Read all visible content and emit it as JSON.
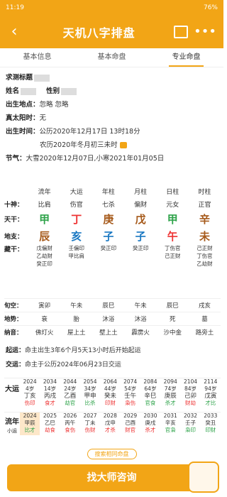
{
  "status": {
    "time": "11:19",
    "battery": "76%"
  },
  "appbar": {
    "title": "天机八字排盘"
  },
  "tabs": [
    "基本信息",
    "基本命盘",
    "专业命盘"
  ],
  "info": {
    "test_label": "求测标题",
    "name_label": "姓名",
    "gender_label": "性别",
    "birthplace_label": "出生地点：",
    "birthplace_value": "忽略 忽略",
    "solar_label": "真太阳时：",
    "solar_value": "无",
    "birthtime_label": "出生时间：",
    "birthtime_value": "公历2020年12月17日 13时18分",
    "lunar_value": "农历2020年冬月初三未时",
    "jieqi_label": "节气：",
    "jieqi_value": "大雪2020年12月07日,小寒2021年01月05日"
  },
  "pillars": {
    "headers": [
      "流年",
      "大运",
      "年柱",
      "月柱",
      "日柱",
      "时柱"
    ],
    "shishen": {
      "label": "十神：",
      "values": [
        "比肩",
        "伤官",
        "七杀",
        "偏财",
        "元女",
        "正官"
      ]
    },
    "tiangan": {
      "label": "天干：",
      "values": [
        "甲",
        "丁",
        "庚",
        "戊",
        "甲",
        "辛"
      ]
    },
    "dizhi": {
      "label": "地支：",
      "values": [
        "辰",
        "亥",
        "子",
        "子",
        "午",
        "未"
      ]
    },
    "canggan": {
      "label": "藏干：",
      "values": [
        "戊偏财\n乙劫财\n癸正印",
        "壬偏印\n甲比肩",
        "癸正印",
        "癸正印",
        "丁伤官\n己正财",
        "己正财\n丁伤官\n乙劫财"
      ]
    }
  },
  "lower": {
    "xunkong": {
      "label": "旬空：",
      "values": [
        "寅卯",
        "午未",
        "辰巳",
        "午未",
        "辰巳",
        "戌亥"
      ]
    },
    "dishi": {
      "label": "地势：",
      "values": [
        "衰",
        "胎",
        "沐浴",
        "沐浴",
        "死",
        "墓"
      ]
    },
    "nayin": {
      "label": "纳音：",
      "values": [
        "佛灯火",
        "屋上土",
        "壁上土",
        "霹雳火",
        "沙中金",
        "路旁土"
      ]
    }
  },
  "qiyun": {
    "label": "起运：",
    "value": "命主出生3年6个月5天13小时后开始起运"
  },
  "jiaoyun": {
    "label": "交运：",
    "value": "命主于公历2024年06月23日交运"
  },
  "dayun": {
    "label": "大运",
    "cols": [
      {
        "year": "2024",
        "age": "4岁",
        "gz": "丁亥",
        "ss": "伤印"
      },
      {
        "year": "2034",
        "age": "14岁",
        "gz": "丙戌",
        "ss": "食才"
      },
      {
        "year": "2044",
        "age": "24岁",
        "gz": "乙酉",
        "ss": "劫官"
      },
      {
        "year": "2054",
        "age": "34岁",
        "gz": "甲申",
        "ss": "比杀"
      },
      {
        "year": "2064",
        "age": "44岁",
        "gz": "癸未",
        "ss": "印财"
      },
      {
        "year": "2074",
        "age": "54岁",
        "gz": "壬午",
        "ss": "枭伤"
      },
      {
        "year": "2084",
        "age": "64岁",
        "gz": "辛巳",
        "ss": "官食"
      },
      {
        "year": "2094",
        "age": "74岁",
        "gz": "庚辰",
        "ss": "杀才"
      },
      {
        "year": "2104",
        "age": "84岁",
        "gz": "己卯",
        "ss": "财劫"
      },
      {
        "year": "2114",
        "age": "94岁",
        "gz": "戊寅",
        "ss": "才比"
      }
    ]
  },
  "liunian": {
    "label": "流年",
    "sub": "小运",
    "cols": [
      {
        "year": "2024",
        "gz": "甲辰",
        "ss": "比才"
      },
      {
        "year": "2025",
        "gz": "乙巳",
        "ss": "劫食"
      },
      {
        "year": "2026",
        "gz": "丙午",
        "ss": "食伤"
      },
      {
        "year": "2027",
        "gz": "丁未",
        "ss": "伤财"
      },
      {
        "year": "2028",
        "gz": "戊申",
        "ss": "才杀"
      },
      {
        "year": "2029",
        "gz": "己酉",
        "ss": "财官"
      },
      {
        "year": "2030",
        "gz": "庚戌",
        "ss": "杀才"
      },
      {
        "year": "2031",
        "gz": "辛亥",
        "ss": "官枭"
      },
      {
        "year": "2032",
        "gz": "壬子",
        "ss": "枭印"
      },
      {
        "year": "2033",
        "gz": "癸丑",
        "ss": "印财"
      }
    ]
  },
  "hint": "搜索相同命盘",
  "cta": "找大师咨询"
}
